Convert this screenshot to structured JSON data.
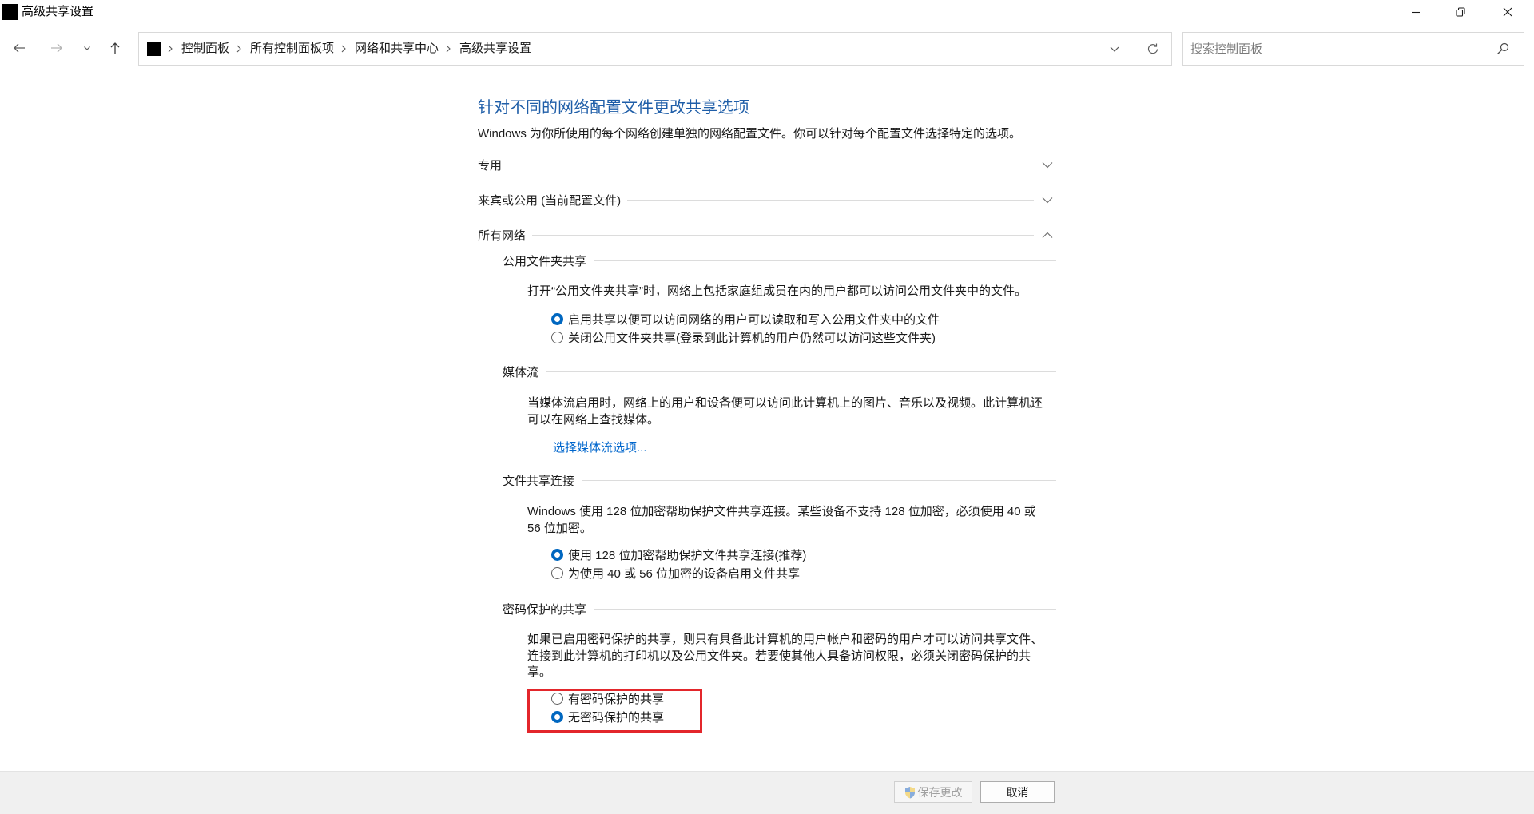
{
  "window": {
    "title": "高级共享设置"
  },
  "address": {
    "breadcrumb": [
      "控制面板",
      "所有控制面板项",
      "网络和共享中心",
      "高级共享设置"
    ]
  },
  "search": {
    "placeholder": "搜索控制面板"
  },
  "page": {
    "heading": "针对不同的网络配置文件更改共享选项",
    "description": "Windows 为你所使用的每个网络创建单独的网络配置文件。你可以针对每个配置文件选择特定的选项。",
    "profiles": [
      {
        "label": "专用",
        "expanded": false
      },
      {
        "label": "来宾或公用 (当前配置文件)",
        "expanded": false
      },
      {
        "label": "所有网络",
        "expanded": true
      }
    ],
    "all_networks": {
      "public_folder_sharing": {
        "title": "公用文件夹共享",
        "description": "打开“公用文件夹共享”时，网络上包括家庭组成员在内的用户都可以访问公用文件夹中的文件。",
        "options": [
          {
            "label": "启用共享以便可以访问网络的用户可以读取和写入公用文件夹中的文件",
            "checked": true
          },
          {
            "label": "关闭公用文件夹共享(登录到此计算机的用户仍然可以访问这些文件夹)",
            "checked": false
          }
        ]
      },
      "media_streaming": {
        "title": "媒体流",
        "description": "当媒体流启用时，网络上的用户和设备便可以访问此计算机上的图片、音乐以及视频。此计算机还可以在网络上查找媒体。",
        "link": "选择媒体流选项..."
      },
      "file_sharing_connections": {
        "title": "文件共享连接",
        "description": "Windows 使用 128 位加密帮助保护文件共享连接。某些设备不支持 128 位加密，必须使用 40 或 56 位加密。",
        "options": [
          {
            "label": "使用 128 位加密帮助保护文件共享连接(推荐)",
            "checked": true
          },
          {
            "label": "为使用 40 或 56 位加密的设备启用文件共享",
            "checked": false
          }
        ]
      },
      "password_protected_sharing": {
        "title": "密码保护的共享",
        "description": "如果已启用密码保护的共享，则只有具备此计算机的用户帐户和密码的用户才可以访问共享文件、连接到此计算机的打印机以及公用文件夹。若要使其他人具备访问权限，必须关闭密码保护的共享。",
        "options": [
          {
            "label": "有密码保护的共享",
            "checked": false
          },
          {
            "label": "无密码保护的共享",
            "checked": true
          }
        ]
      }
    }
  },
  "footer": {
    "save_label": "保存更改",
    "save_enabled": false,
    "cancel_label": "取消"
  },
  "icons": {
    "window": "app-icon",
    "minimize": "minimize-icon",
    "restore": "restore-icon",
    "close": "close-icon",
    "back": "arrow-left-icon",
    "forward": "arrow-right-icon",
    "recent_locations": "chevron-down-icon",
    "up": "arrow-up-icon",
    "location": "control-panel-icon",
    "breadcrumb_separator": "chevron-right-icon",
    "address_dropdown": "chevron-down-icon",
    "refresh": "refresh-icon",
    "search": "search-icon",
    "profile_collapsed": "chevron-down-icon",
    "profile_expanded": "chevron-up-icon",
    "save": "uac-shield-icon"
  },
  "colors": {
    "accent": "#0067c0",
    "heading": "#1f5ea8",
    "link": "#0066cc",
    "highlight_box": "#e3262b",
    "footer_background": "#f0f0f0",
    "divider": "#dcdcdc",
    "text": "#1a1a1a"
  }
}
